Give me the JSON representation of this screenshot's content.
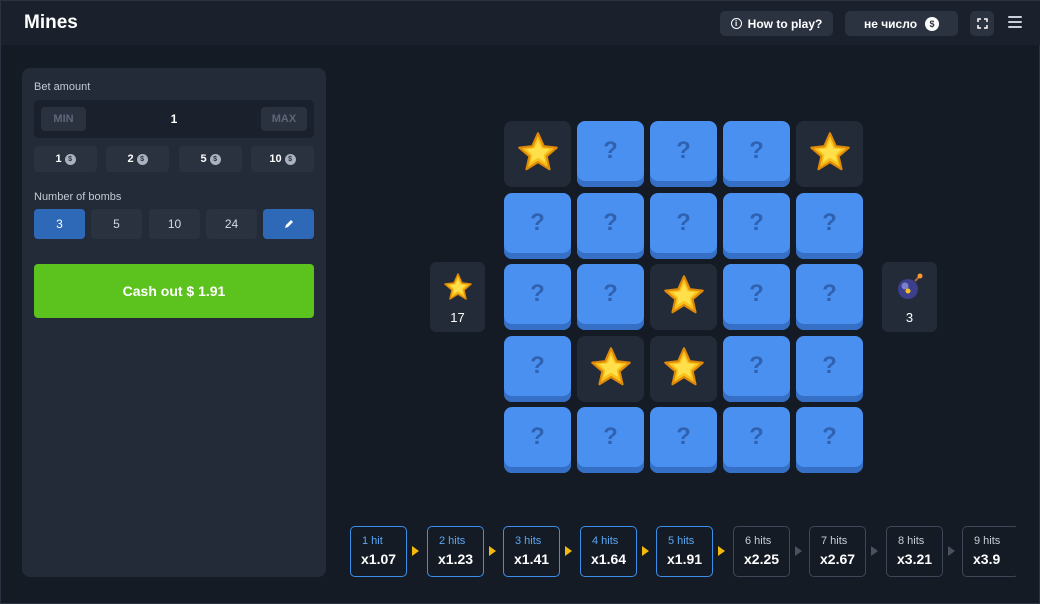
{
  "header": {
    "title": "Mines",
    "how_to_play": "How to play?",
    "currency_label": "не число",
    "coin_symbol": "$"
  },
  "bet": {
    "label": "Bet amount",
    "min": "MIN",
    "max": "MAX",
    "value": "1",
    "quick": [
      "1",
      "2",
      "5",
      "10"
    ]
  },
  "bombs": {
    "label": "Number of bombs",
    "options": [
      "3",
      "5",
      "10",
      "24"
    ],
    "selected": "3"
  },
  "cashout": {
    "label": "Cash out $ 1.91"
  },
  "board": {
    "rows": [
      [
        "star",
        "hidden",
        "hidden",
        "hidden",
        "star"
      ],
      [
        "hidden",
        "hidden",
        "hidden",
        "hidden",
        "hidden"
      ],
      [
        "hidden",
        "hidden",
        "star",
        "hidden",
        "hidden"
      ],
      [
        "hidden",
        "star",
        "star",
        "hidden",
        "hidden"
      ],
      [
        "hidden",
        "hidden",
        "hidden",
        "hidden",
        "hidden"
      ]
    ],
    "hidden_symbol": "?"
  },
  "counters": {
    "stars_left": "17",
    "bombs": "3"
  },
  "multipliers": [
    {
      "hits": "1 hit",
      "value": "x1.07",
      "reached": true
    },
    {
      "hits": "2 hits",
      "value": "x1.23",
      "reached": true
    },
    {
      "hits": "3 hits",
      "value": "x1.41",
      "reached": true
    },
    {
      "hits": "4 hits",
      "value": "x1.64",
      "reached": true
    },
    {
      "hits": "5 hits",
      "value": "x1.91",
      "reached": true
    },
    {
      "hits": "6 hits",
      "value": "x2.25",
      "reached": false
    },
    {
      "hits": "7 hits",
      "value": "x2.67",
      "reached": false
    },
    {
      "hits": "8 hits",
      "value": "x3.21",
      "reached": false
    },
    {
      "hits": "9 hits",
      "value": "x3.9",
      "reached": false
    }
  ],
  "colors": {
    "accent_blue": "#2e69b8",
    "tile_blue": "#4a90f0",
    "cashout_green": "#5cc21d",
    "star_yellow": "#f7c21a",
    "arrow_yellow": "#f2b90e"
  },
  "icons": {
    "info": "info-icon",
    "fullscreen": "fullscreen-icon",
    "menu": "hamburger-menu-icon",
    "edit": "pencil-icon",
    "star": "star-icon",
    "bomb": "bomb-icon"
  }
}
